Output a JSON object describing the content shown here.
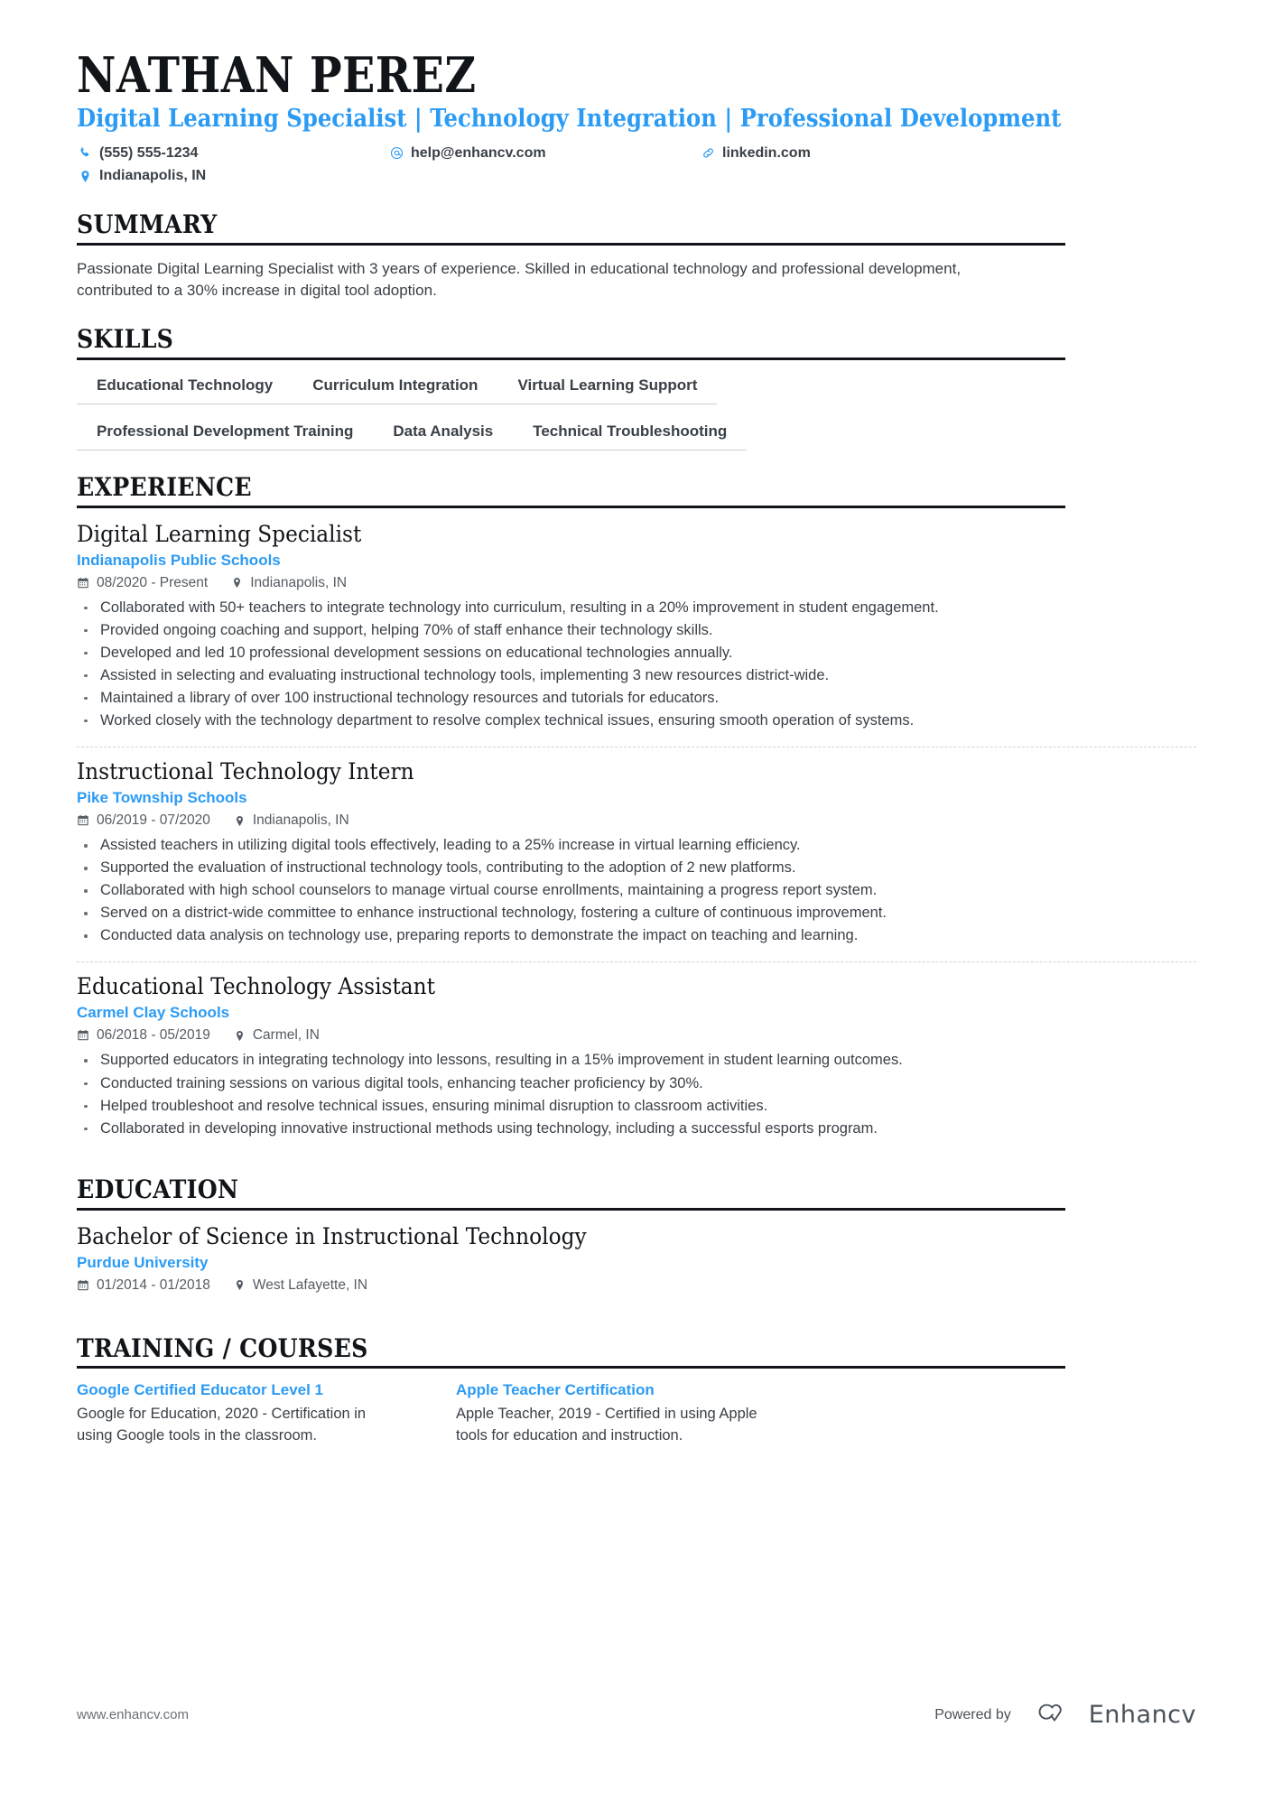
{
  "header": {
    "name": "NATHAN PEREZ",
    "headline": "Digital Learning Specialist | Technology Integration | Professional Development",
    "contacts": [
      {
        "icon": "phone-icon",
        "text": "(555) 555-1234"
      },
      {
        "icon": "email-icon",
        "text": "help@enhancv.com"
      },
      {
        "icon": "link-icon",
        "text": "linkedin.com"
      },
      {
        "icon": "location-icon",
        "text": "Indianapolis, IN"
      }
    ]
  },
  "summary": {
    "title": "SUMMARY",
    "text": "Passionate Digital Learning Specialist with 3 years of experience. Skilled in educational technology and professional development, contributed to a 30% increase in digital tool adoption."
  },
  "skills": {
    "title": "SKILLS",
    "rows": [
      [
        "Educational Technology",
        "Curriculum Integration",
        "Virtual Learning Support"
      ],
      [
        "Professional Development Training",
        "Data Analysis",
        "Technical Troubleshooting"
      ]
    ]
  },
  "experience": {
    "title": "EXPERIENCE",
    "entries": [
      {
        "title": "Digital Learning Specialist",
        "org": "Indianapolis Public Schools",
        "dates": "08/2020 - Present",
        "location": "Indianapolis, IN",
        "bullets": [
          "Collaborated with 50+ teachers to integrate technology into curriculum, resulting in a 20% improvement in student engagement.",
          "Provided ongoing coaching and support, helping 70% of staff enhance their technology skills.",
          "Developed and led 10 professional development sessions on educational technologies annually.",
          "Assisted in selecting and evaluating instructional technology tools, implementing 3 new resources district-wide.",
          "Maintained a library of over 100 instructional technology resources and tutorials for educators.",
          "Worked closely with the technology department to resolve complex technical issues, ensuring smooth operation of systems."
        ]
      },
      {
        "title": "Instructional Technology Intern",
        "org": "Pike Township Schools",
        "dates": "06/2019 - 07/2020",
        "location": "Indianapolis, IN",
        "bullets": [
          "Assisted teachers in utilizing digital tools effectively, leading to a 25% increase in virtual learning efficiency.",
          "Supported the evaluation of instructional technology tools, contributing to the adoption of 2 new platforms.",
          "Collaborated with high school counselors to manage virtual course enrollments, maintaining a progress report system.",
          "Served on a district-wide committee to enhance instructional technology, fostering a culture of continuous improvement.",
          "Conducted data analysis on technology use, preparing reports to demonstrate the impact on teaching and learning."
        ]
      },
      {
        "title": "Educational Technology Assistant",
        "org": "Carmel Clay Schools",
        "dates": "06/2018 - 05/2019",
        "location": "Carmel, IN",
        "bullets": [
          "Supported educators in integrating technology into lessons, resulting in a 15% improvement in student learning outcomes.",
          "Conducted training sessions on various digital tools, enhancing teacher proficiency by 30%.",
          "Helped troubleshoot and resolve technical issues, ensuring minimal disruption to classroom activities.",
          "Collaborated in developing innovative instructional methods using technology, including a successful esports program."
        ]
      }
    ]
  },
  "education": {
    "title": "EDUCATION",
    "entries": [
      {
        "title": "Bachelor of Science in Instructional Technology",
        "org": "Purdue University",
        "dates": "01/2014 - 01/2018",
        "location": "West Lafayette, IN"
      }
    ]
  },
  "training": {
    "title": "TRAINING / COURSES",
    "courses": [
      {
        "title": "Google Certified Educator Level 1",
        "desc": "Google for Education, 2020 - Certification in using Google tools in the classroom."
      },
      {
        "title": "Apple Teacher Certification",
        "desc": "Apple Teacher, 2019 - Certified in using Apple tools for education and instruction."
      }
    ]
  },
  "footer": {
    "url": "www.enhancv.com",
    "powered_by": "Powered by",
    "brand": "Enhancv"
  },
  "colors": {
    "accent": "#2b9bf4",
    "text": "#3a4047",
    "heading": "#111418",
    "rule": "#111418",
    "tag_border": "#c9ced4"
  }
}
